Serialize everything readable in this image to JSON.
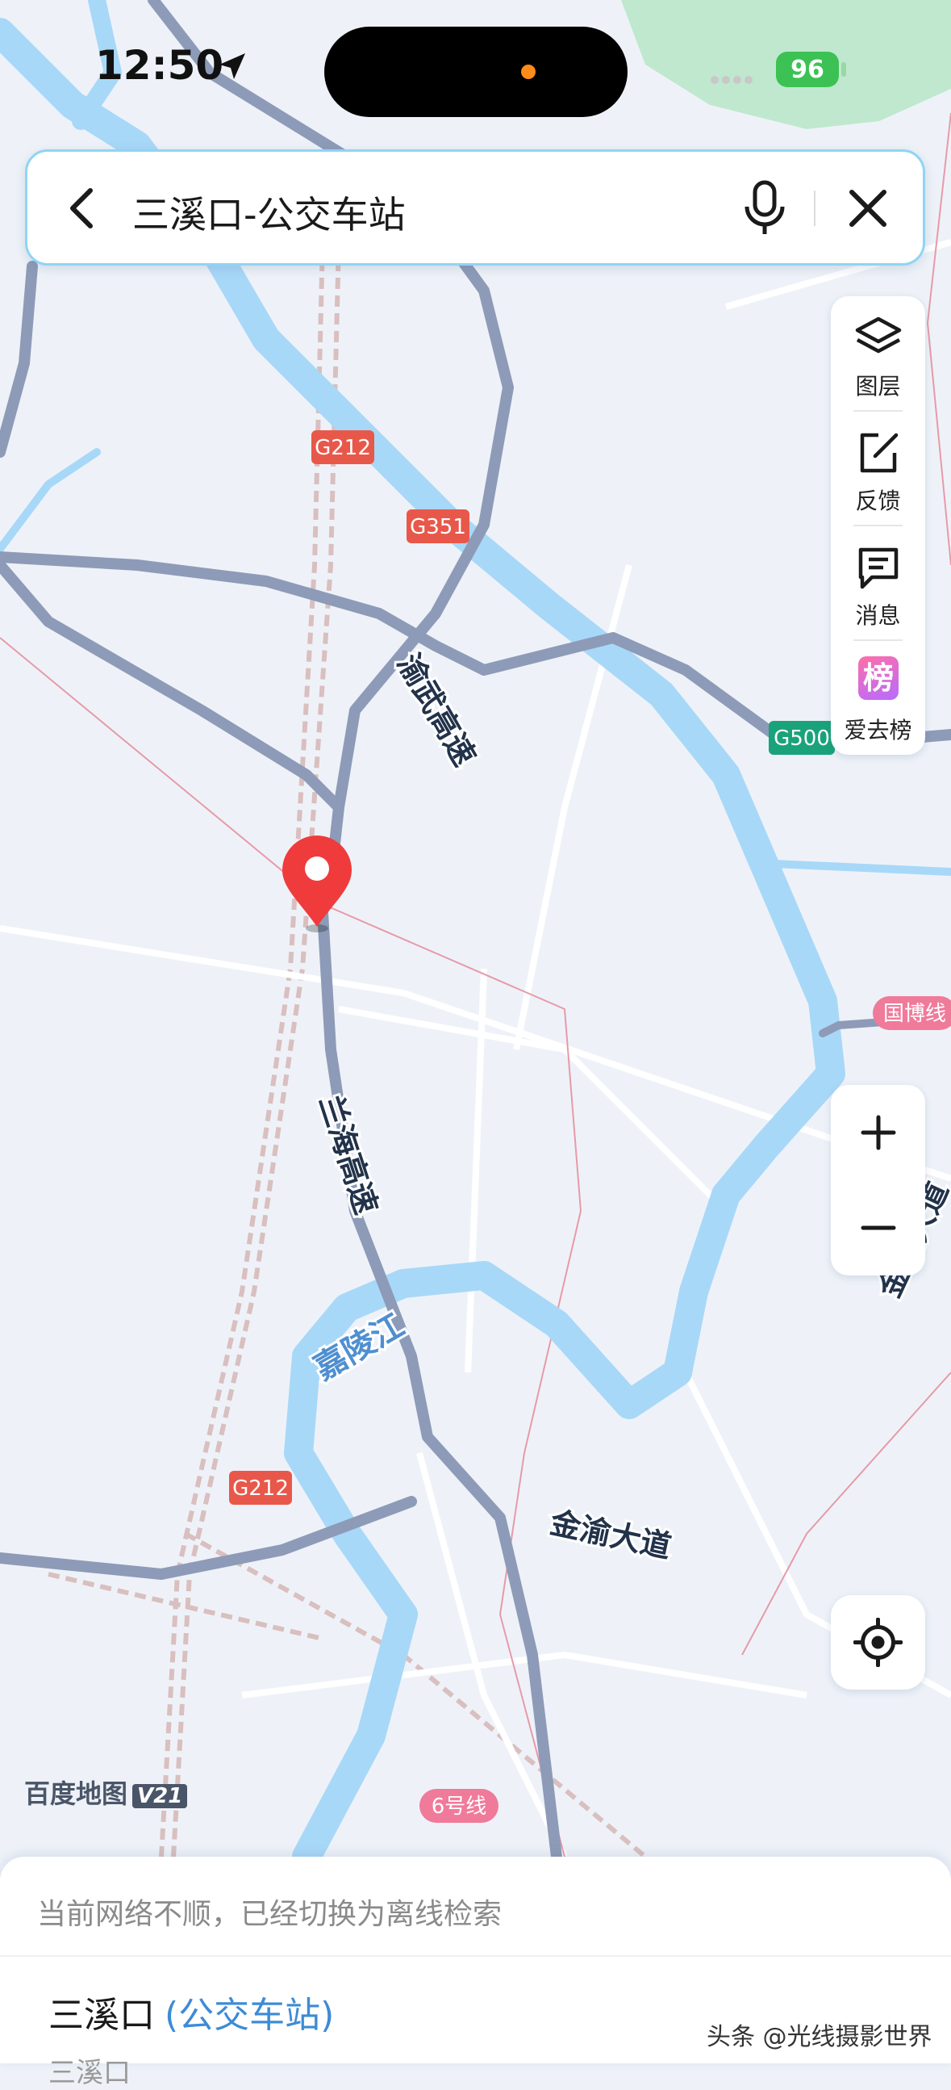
{
  "status_bar": {
    "time": "12:50",
    "battery": "96"
  },
  "search": {
    "query": "三溪口-公交车站"
  },
  "map_tools": [
    {
      "label": "图层",
      "icon": "layers-icon"
    },
    {
      "label": "反馈",
      "icon": "feedback-icon"
    },
    {
      "label": "消息",
      "icon": "message-icon"
    },
    {
      "label": "爱去榜",
      "icon": "ranking-icon",
      "badge": "榜"
    }
  ],
  "map": {
    "road_shields": [
      "G212",
      "G351",
      "G500",
      "G212"
    ],
    "road_names": [
      "渝武高速",
      "兰海高速",
      "金渝大道",
      "金山大道"
    ],
    "river_name": "嘉陵江",
    "transit_labels": [
      "国博线",
      "6号线"
    ],
    "marker": "map-pin-icon",
    "colors": {
      "river": "#a8d8f8",
      "expressway": "#8d9bb8",
      "shield_national": "#e8584a",
      "shield_highway": "#1aa37a",
      "metro": "#f07a9a",
      "pin": "#ef3b3b"
    }
  },
  "logo": {
    "text": "百度地图",
    "version": "V21"
  },
  "bottom_sheet": {
    "notice": "当前网络不顺，已经切换为离线检索",
    "result_name": "三溪口",
    "result_type": "(公交车站)",
    "result_sub": "三溪口"
  },
  "watermark": "头条 @光线摄影世界"
}
